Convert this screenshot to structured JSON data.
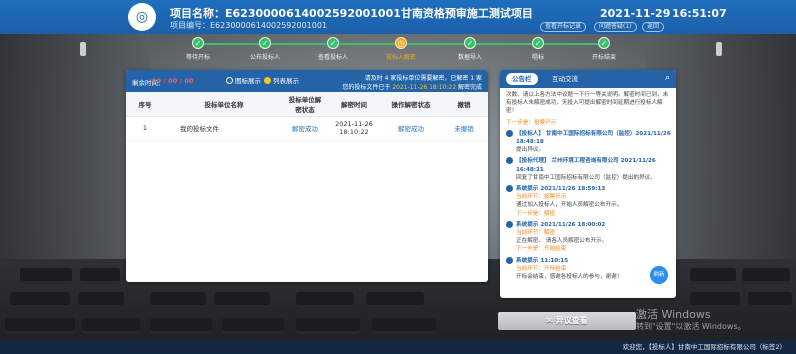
{
  "header": {
    "project_name": "项目名称：E6230000614002592001001甘南资格预审施工测试项目",
    "project_code": "项目编号：E6230000614002592001001",
    "date": "2021-11-29",
    "time": "16:51:07",
    "btn_1": "查看开标记录",
    "btn_2": "问题答疑(1)",
    "btn_3": "返回"
  },
  "steps": [
    {
      "label": "等待开标",
      "state": "done"
    },
    {
      "label": "公布投标人",
      "state": "done"
    },
    {
      "label": "查看投标人",
      "state": "done"
    },
    {
      "label": "投标人解密",
      "state": "current"
    },
    {
      "label": "数据导入",
      "state": "done"
    },
    {
      "label": "唱标",
      "state": "done"
    },
    {
      "label": "开标结束",
      "state": "done"
    }
  ],
  "main": {
    "countdown_label": "剩余时间：",
    "countdown_value": "00 : 00 : 00",
    "radio_1": "图标展示",
    "radio_2": "列表展示",
    "status_line1": "请及时 4 家投标单位需要解密，已解密 1 家",
    "status_line2_prefix": "您的投标文件已于",
    "status_line2_time": "2021-11-26 18:10:22",
    "status_line2_suffix": "解密完成",
    "columns": [
      "序号",
      "投标单位名称",
      "投标单位解密状态",
      "解密时间",
      "操作解密状态",
      "撤销"
    ],
    "rows": [
      {
        "no": "1",
        "name": "我的投标文件",
        "status": "解密成功",
        "time": "2021-11-26 18:10:22",
        "op": "解密成功",
        "revoke": "未撤销"
      }
    ]
  },
  "chat": {
    "tab_1": "公告栏",
    "tab_2": "互动交流",
    "float_label": "刷新",
    "messages": [
      {
        "kind": "plain",
        "text": "次数、请以上各方法中议题一下行一等关说明。解密时间已到，未有投标人未解密成功，无投入可提出解密时间延期进行投标人解密！"
      },
      {
        "kind": "plain_sub",
        "text": "下一步是：投票开示"
      },
      {
        "kind": "msg",
        "who": "【投标人】 甘南中工国际招标有限公司（监控）2021/11/26 18:48:18",
        "sub": "",
        "text": "提出异议。"
      },
      {
        "kind": "msg",
        "who": "【投标代理】 兰州环境工程咨询有限公司 2021/11/26 16:48:21",
        "sub": "",
        "text": "回复了甘南中工国际招标有限公司（监控）提出的异议。"
      },
      {
        "kind": "msg",
        "who": "系统提示 2021/11/26 18:59:13",
        "sub": "当前环节：投票开示",
        "text": "通过加入投标人，开始人员解密公布开示。"
      },
      {
        "kind": "msg_sub",
        "who": "",
        "sub": "下一步是：解密",
        "text": ""
      },
      {
        "kind": "msg",
        "who": "系统提示 2021/11/26 18:00:02",
        "sub": "当前环节：解密",
        "text": "正在解密。 请各人员解密公布开示。"
      },
      {
        "kind": "msg_sub",
        "who": "",
        "sub": "下一步是：开始结束",
        "text": ""
      },
      {
        "kind": "msg",
        "who": "系统提示 11:10:15",
        "sub": "当前环节：开标结束",
        "text": "开标会结束，感谢各投标人的参与，谢谢！"
      }
    ]
  },
  "objection_button": "异议查看",
  "watermark_line1": "激活 Windows",
  "watermark_line2": "转到\"设置\"以激活 Windows。",
  "footer_text": "欢迎您，【投标人】甘南中工国际招标有限公司（标签2）",
  "colors": {
    "primary": "#2463a8",
    "success": "#39c06a",
    "current_step": "#f3a623",
    "link": "#1f6fbf"
  }
}
